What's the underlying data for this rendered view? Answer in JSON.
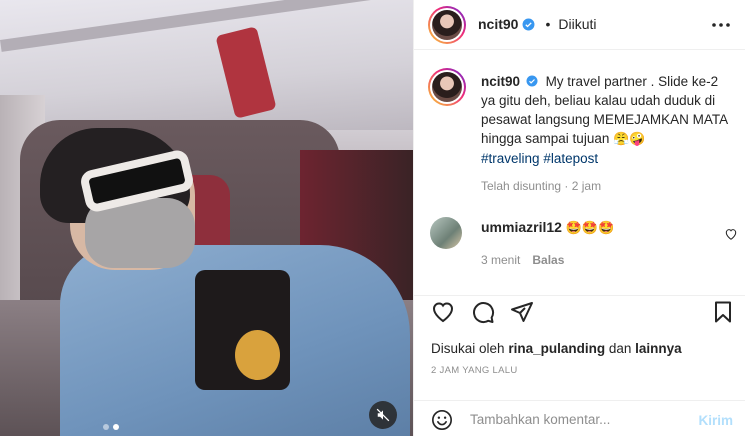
{
  "post": {
    "username": "ncit90",
    "follow_status": "Diikuti",
    "separator": "•",
    "verified": true
  },
  "caption": {
    "username": "ncit90",
    "text": "My travel partner . Slide ke-2 ya gitu deh, beliau kalau udah duduk di pesawat langsung MEMEJAMKAN MATA hingga sampai tujuan",
    "emojis": "😤🤪",
    "hashtags": [
      "#traveling",
      "#latepost"
    ],
    "meta": "Telah disunting · 2 jam"
  },
  "comments": [
    {
      "username": "ummiazril12",
      "text": "🤩🤩🤩",
      "time": "3 menit",
      "reply_label": "Balas"
    }
  ],
  "actions": {
    "icons": [
      "heart-icon",
      "comment-icon",
      "share-icon",
      "bookmark-icon"
    ]
  },
  "likes": {
    "prefix": "Disukai oleh",
    "user": "rina_pulanding",
    "conjunction": "dan",
    "others": "lainnya"
  },
  "timestamp": "2 JAM YANG LALU",
  "add_comment": {
    "placeholder": "Tambahkan komentar...",
    "post_label": "Kirim"
  },
  "media": {
    "carousel_count": 2,
    "carousel_active": 2,
    "muted": true
  },
  "colors": {
    "verified": "#3897f0",
    "hashtag": "#00376b",
    "muted_text": "#8e8e8e",
    "post_button": "#b2dffc"
  }
}
